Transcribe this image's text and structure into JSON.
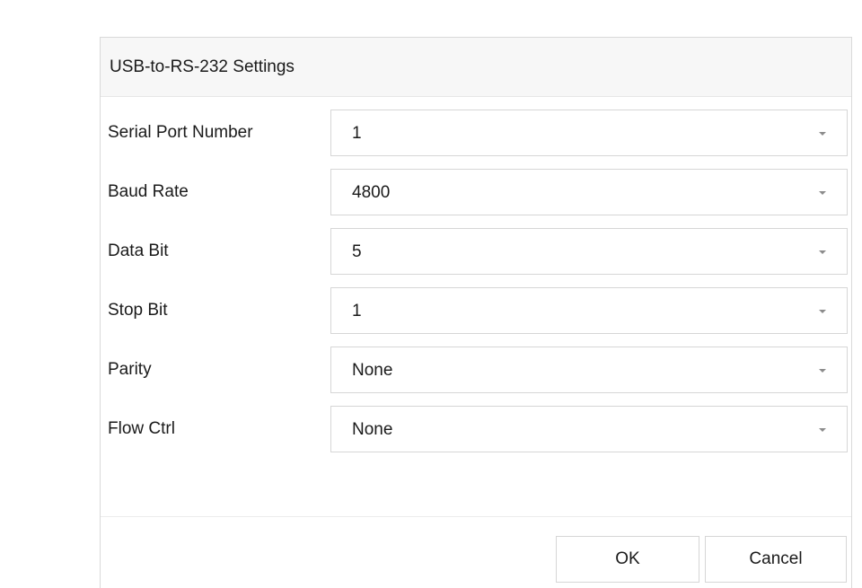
{
  "dialog": {
    "title": "USB-to-RS-232 Settings"
  },
  "fields": [
    {
      "label": "Serial Port Number",
      "value": "1"
    },
    {
      "label": "Baud Rate",
      "value": "4800"
    },
    {
      "label": "Data Bit",
      "value": "5"
    },
    {
      "label": "Stop Bit",
      "value": "1"
    },
    {
      "label": "Parity",
      "value": "None"
    },
    {
      "label": "Flow Ctrl",
      "value": "None"
    }
  ],
  "buttons": {
    "ok_label": "OK",
    "cancel_label": "Cancel"
  },
  "icons": {
    "dropdown": "chevron-down-icon"
  }
}
